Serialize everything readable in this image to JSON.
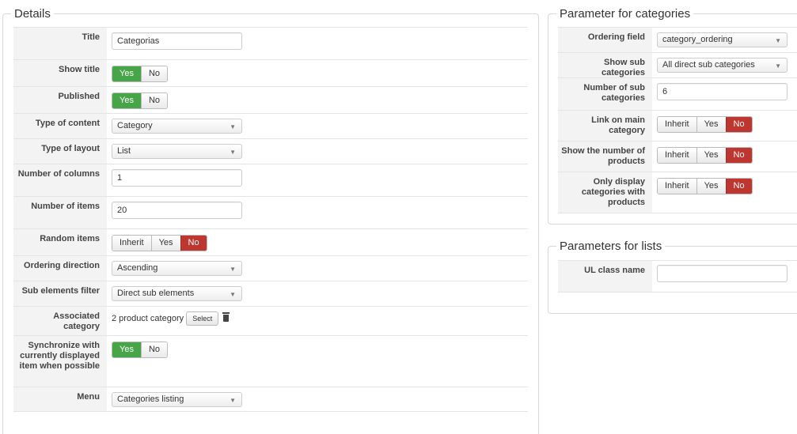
{
  "details": {
    "legend": "Details",
    "title": {
      "label": "Title",
      "value": "Categorias"
    },
    "show_title": {
      "label": "Show title",
      "options": [
        "Yes",
        "No"
      ]
    },
    "published": {
      "label": "Published",
      "options": [
        "Yes",
        "No"
      ]
    },
    "type_of_content": {
      "label": "Type of content",
      "value": "Category"
    },
    "type_of_layout": {
      "label": "Type of layout",
      "value": "List"
    },
    "number_of_columns": {
      "label": "Number of columns",
      "value": "1"
    },
    "number_of_items": {
      "label": "Number of items",
      "value": "20"
    },
    "random_items": {
      "label": "Random items",
      "options": [
        "Inherit",
        "Yes",
        "No"
      ]
    },
    "ordering_direction": {
      "label": "Ordering direction",
      "value": "Ascending"
    },
    "sub_elements_filter": {
      "label": "Sub elements filter",
      "value": "Direct sub elements"
    },
    "associated_category": {
      "label": "Associated category",
      "value": "2 product category",
      "button": "Select"
    },
    "synchronize": {
      "label": "Synchronize with currently displayed item when possible",
      "options": [
        "Yes",
        "No"
      ]
    },
    "menu": {
      "label": "Menu",
      "value": "Categories listing"
    }
  },
  "categories_params": {
    "legend": "Parameter for categories",
    "ordering_field": {
      "label": "Ordering field",
      "value": "category_ordering"
    },
    "show_sub_categories": {
      "label": "Show sub categories",
      "value": "All direct sub categories"
    },
    "number_of_sub_categories": {
      "label": "Number of sub categories",
      "value": "6"
    },
    "link_on_main": {
      "label": "Link on main category",
      "options": [
        "Inherit",
        "Yes",
        "No"
      ]
    },
    "show_number_products": {
      "label": "Show the number of products",
      "options": [
        "Inherit",
        "Yes",
        "No"
      ]
    },
    "only_display": {
      "label": "Only display categories with products",
      "options": [
        "Inherit",
        "Yes",
        "No"
      ]
    }
  },
  "lists_params": {
    "legend": "Parameters for lists",
    "ul_class_name": {
      "label": "UL class name",
      "value": ""
    }
  },
  "colors": {
    "yes_active": "#46a546",
    "no_active": "#bd362f",
    "label_bg": "#f3f3f3"
  },
  "icons": {
    "dropdown": "chevron-down-icon",
    "delete": "trash-icon"
  }
}
